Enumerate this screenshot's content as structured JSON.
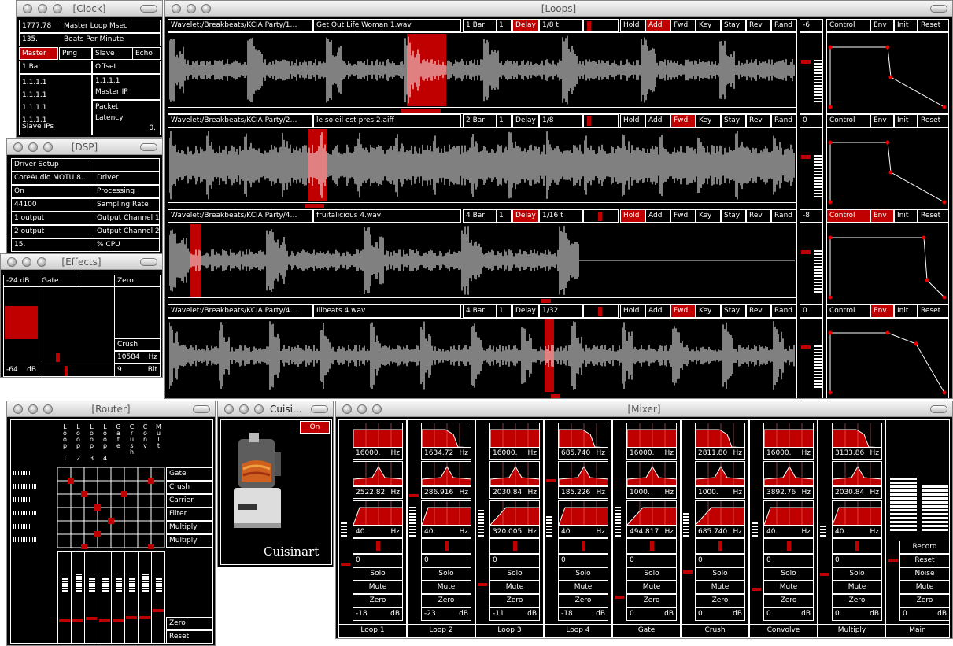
{
  "clock": {
    "title": "[Clock]",
    "msec": "1777.78",
    "msec_label": "Master Loop Msec",
    "bpm": "135.",
    "bpm_label": "Beats Per Minute",
    "master": "Master",
    "ping": "Ping",
    "slave": "Slave",
    "echo": "Echo",
    "bar": "1 Bar",
    "offset": "Offset",
    "ips": [
      "1.1.1.1",
      "1.1.1.1",
      "1.1.1.1",
      "1.1.1.1"
    ],
    "slave_ips": "Slave IPs",
    "master_ip_val": "1.1.1.1",
    "master_ip": "Master IP",
    "packet": "Packet",
    "latency": "Latency",
    "latency_val": "0."
  },
  "dsp": {
    "title": "[DSP]",
    "driver_setup": "Driver Setup",
    "driver_val": "CoreAudio MOTU 8…",
    "driver": "Driver",
    "on": "On",
    "processing": "Processing",
    "rate": "44100",
    "rate_label": "Sampling Rate",
    "out1": "1 output",
    "out1_label": "Output Channel 1",
    "out2": "2 output",
    "out2_label": "Output Channel 2",
    "cpu": "15.",
    "cpu_label": "% CPU"
  },
  "effects": {
    "title": "[Effects]",
    "db_top": "-24",
    "db_bot": "-64",
    "db": "dB",
    "gate": "Gate",
    "zero": "Zero",
    "crush": "Crush",
    "hz_val": "10584",
    "hz": "Hz",
    "bit_val": "9",
    "bit": "Bit"
  },
  "loops": {
    "title": "[Loops]",
    "rows": [
      {
        "path": "Wavelet:/Breakbeats/KCIA Party/1…",
        "file": "Get Out Life Woman 1.wav",
        "bars": "1 Bar",
        "n": "1",
        "delay": "Delay",
        "div": "1/8 t",
        "hold": "Hold",
        "add": "Add",
        "fwd": "Fwd",
        "key": "Key",
        "stay": "Stay",
        "rev": "Rev",
        "rand": "Rand",
        "num": "-6",
        "control": "Control",
        "env": "Env",
        "init": "Init",
        "reset": "Reset",
        "delay_on": true,
        "add_on": true,
        "fwd_on": false,
        "hold_on": false,
        "control_on": false,
        "env_on": false
      },
      {
        "path": "Wavelet:/Breakbeats/KCIA Party/2…",
        "file": "le soleil est pres 2.aiff",
        "bars": "2 Bar",
        "n": "1",
        "delay": "Delay",
        "div": "1/8",
        "hold": "Hold",
        "add": "Add",
        "fwd": "Fwd",
        "key": "Key",
        "stay": "Stay",
        "rev": "Rev",
        "rand": "Rand",
        "num": "0",
        "control": "Control",
        "env": "Env",
        "init": "Init",
        "reset": "Reset",
        "delay_on": false,
        "add_on": false,
        "fwd_on": true,
        "hold_on": false,
        "control_on": false,
        "env_on": false
      },
      {
        "path": "Wavelet:/Breakbeats/KCIA Party/4…",
        "file": "fruitalicious 4.wav",
        "bars": "4 Bar",
        "n": "1",
        "delay": "Delay",
        "div": "1/16 t",
        "hold": "Hold",
        "add": "Add",
        "fwd": "Fwd",
        "key": "Key",
        "stay": "Stay",
        "rev": "Rev",
        "rand": "Rand",
        "num": "-8",
        "control": "Control",
        "env": "Env",
        "init": "Init",
        "reset": "Reset",
        "delay_on": true,
        "add_on": false,
        "fwd_on": false,
        "hold_on": true,
        "control_on": true,
        "env_on": true
      },
      {
        "path": "Wavelet:/Breakbeats/KCIA Party/4…",
        "file": "Illbeats 4.wav",
        "bars": "4 Bar",
        "n": "1",
        "delay": "Delay",
        "div": "1/32",
        "hold": "Hold",
        "add": "Add",
        "fwd": "Fwd",
        "key": "Key",
        "stay": "Stay",
        "rev": "Rev",
        "rand": "Rand",
        "num": "0",
        "control": "Control",
        "env": "Env",
        "init": "Init",
        "reset": "Reset",
        "delay_on": false,
        "add_on": false,
        "fwd_on": true,
        "hold_on": false,
        "control_on": false,
        "env_on": true
      }
    ]
  },
  "router": {
    "title": "[Router]",
    "cols": [
      "Loop 1",
      "Loop 2",
      "Loop 3",
      "Loop 4",
      "Gate",
      "Crush",
      "Conv",
      "Mult"
    ],
    "rows": [
      "Gate",
      "Crush",
      "Carrier",
      "Filter",
      "Multiply",
      "Multiply"
    ],
    "zero": "Zero",
    "reset": "Reset"
  },
  "cuisinart": {
    "title": "Cuisi…",
    "on": "On",
    "brand": "Cuisinart"
  },
  "mixer": {
    "title": "[Mixer]",
    "channels": [
      {
        "hz1": "16000.",
        "hz2": "2522.82",
        "hz3": "40.",
        "hz": "Hz",
        "val": "0",
        "solo": "Solo",
        "mute": "Mute",
        "zero": "Zero",
        "db_val": "-18",
        "db": "dB",
        "name": "Loop 1"
      },
      {
        "hz1": "1634.72",
        "hz2": "286.916",
        "hz3": "40.",
        "hz": "Hz",
        "val": "0",
        "solo": "Solo",
        "mute": "Mute",
        "zero": "Zero",
        "db_val": "-23",
        "db": "dB",
        "name": "Loop 2"
      },
      {
        "hz1": "16000.",
        "hz2": "2030.84",
        "hz3": "320.005",
        "hz": "Hz",
        "val": "0",
        "solo": "Solo",
        "mute": "Mute",
        "zero": "Zero",
        "db_val": "-11",
        "db": "dB",
        "name": "Loop 3"
      },
      {
        "hz1": "685.740",
        "hz2": "185.226",
        "hz3": "40.",
        "hz": "Hz",
        "val": "0",
        "solo": "Solo",
        "mute": "Mute",
        "zero": "Zero",
        "db_val": "-18",
        "db": "dB",
        "name": "Loop 4"
      },
      {
        "hz1": "16000.",
        "hz2": "1000.",
        "hz3": "494.817",
        "hz": "Hz",
        "val": "0",
        "solo": "Solo",
        "mute": "Mute",
        "zero": "Zero",
        "db_val": "0",
        "db": "dB",
        "name": "Gate"
      },
      {
        "hz1": "2811.80",
        "hz2": "1000.",
        "hz3": "685.740",
        "hz": "Hz",
        "val": "0",
        "solo": "Solo",
        "mute": "Mute",
        "zero": "Zero",
        "db_val": "0",
        "db": "dB",
        "name": "Crush"
      },
      {
        "hz1": "16000.",
        "hz2": "3892.76",
        "hz3": "40.",
        "hz": "Hz",
        "val": "0",
        "solo": "Solo",
        "mute": "Mute",
        "zero": "Zero",
        "db_val": "0",
        "db": "dB",
        "name": "Convolve"
      },
      {
        "hz1": "3133.86",
        "hz2": "2030.84",
        "hz3": "40.",
        "hz": "Hz",
        "val": "0",
        "solo": "Solo",
        "mute": "Mute",
        "zero": "Zero",
        "db_val": "0",
        "db": "dB",
        "name": "Multiply"
      }
    ],
    "main": {
      "record": "Record",
      "reset": "Reset",
      "noise": "Noise",
      "mute": "Mute",
      "zero": "Zero",
      "db_val": "0",
      "db": "dB",
      "name": "Main"
    }
  },
  "colors": {
    "accent": "#c00000",
    "bg": "#000000",
    "fg": "#ffffff"
  }
}
